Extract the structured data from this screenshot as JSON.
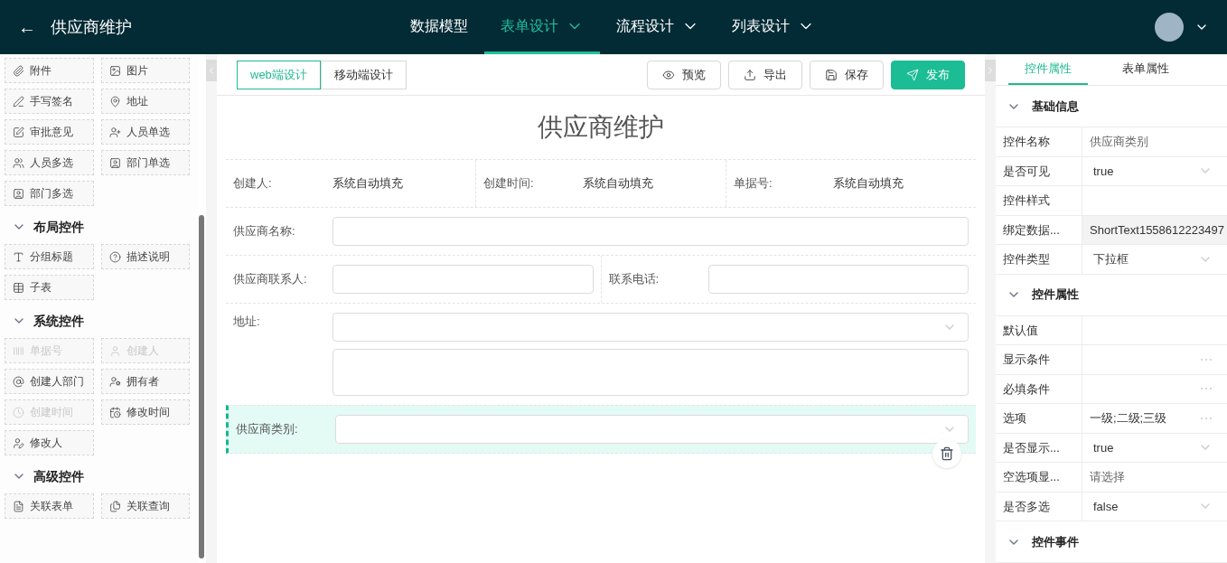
{
  "header": {
    "back": "←",
    "title": "供应商维护",
    "nav": [
      {
        "label": "数据模型",
        "selected": false,
        "dropdown": false
      },
      {
        "label": "表单设计",
        "selected": true,
        "dropdown": true
      },
      {
        "label": "流程设计",
        "selected": false,
        "dropdown": true
      },
      {
        "label": "列表设计",
        "selected": false,
        "dropdown": true
      }
    ]
  },
  "palette": [
    {
      "items": [
        {
          "label": "附件",
          "disabled": false
        },
        {
          "label": "图片",
          "disabled": false
        },
        {
          "label": "手写签名",
          "disabled": false
        },
        {
          "label": "地址",
          "disabled": false
        },
        {
          "label": "审批意见",
          "disabled": false
        },
        {
          "label": "人员单选",
          "disabled": false
        },
        {
          "label": "人员多选",
          "disabled": false
        },
        {
          "label": "部门单选",
          "disabled": false
        },
        {
          "label": "部门多选",
          "disabled": false
        }
      ]
    },
    {
      "title": "布局控件",
      "expanded": true,
      "items": [
        {
          "label": "分组标题",
          "disabled": false
        },
        {
          "label": "描述说明",
          "disabled": false
        },
        {
          "label": "子表",
          "disabled": false
        }
      ]
    },
    {
      "title": "系统控件",
      "expanded": true,
      "items": [
        {
          "label": "单据号",
          "disabled": true
        },
        {
          "label": "创建人",
          "disabled": true
        },
        {
          "label": "创建人部门",
          "disabled": false
        },
        {
          "label": "拥有者",
          "disabled": false
        },
        {
          "label": "创建时间",
          "disabled": true
        },
        {
          "label": "修改时间",
          "disabled": false
        },
        {
          "label": "修改人",
          "disabled": false
        }
      ]
    },
    {
      "title": "高级控件",
      "expanded": true,
      "items": [
        {
          "label": "关联表单",
          "disabled": false
        },
        {
          "label": "关联查询",
          "disabled": false
        }
      ]
    }
  ],
  "toolbar": {
    "modes": [
      {
        "label": "web端设计",
        "selected": true
      },
      {
        "label": "移动端设计",
        "selected": false
      }
    ],
    "actions": [
      {
        "label": "预览",
        "primary": false
      },
      {
        "label": "导出",
        "primary": false
      },
      {
        "label": "保存",
        "primary": false
      },
      {
        "label": "发布",
        "primary": true
      }
    ]
  },
  "form": {
    "title": "供应商维护",
    "rows": [
      {
        "selected": false,
        "fields": [
          {
            "label": "创建人:",
            "kind": "info",
            "value": "系统自动填充"
          },
          {
            "label": "创建时间:",
            "kind": "info",
            "value": "系统自动填充"
          },
          {
            "label": "单据号:",
            "kind": "info",
            "value": "系统自动填充"
          }
        ]
      },
      {
        "selected": false,
        "fields": [
          {
            "label": "供应商名称:",
            "kind": "input"
          }
        ]
      },
      {
        "selected": false,
        "fields": [
          {
            "label": "供应商联系人:",
            "kind": "input"
          },
          {
            "label": "联系电话:",
            "kind": "input"
          }
        ]
      },
      {
        "selected": false,
        "fields": [
          {
            "label": "地址:",
            "kind": "address"
          }
        ]
      },
      {
        "selected": true,
        "fields": [
          {
            "label": "供应商类别:",
            "kind": "select"
          }
        ]
      }
    ]
  },
  "properties": {
    "tabs": [
      {
        "label": "控件属性",
        "selected": true
      },
      {
        "label": "表单属性",
        "selected": false
      }
    ],
    "sections": [
      {
        "title": "基础信息",
        "expanded": true,
        "rows": [
          {
            "label": "控件名称",
            "kind": "text",
            "value": "供应商类别"
          },
          {
            "label": "是否可见",
            "kind": "select",
            "value": "true"
          },
          {
            "label": "控件样式",
            "kind": "text"
          },
          {
            "label": "绑定数据...",
            "kind": "readonly",
            "value": "ShortText1558612223497"
          },
          {
            "label": "控件类型",
            "kind": "select",
            "value": "下拉框"
          }
        ]
      },
      {
        "title": "控件属性",
        "expanded": true,
        "rows": [
          {
            "label": "默认值",
            "kind": "text"
          },
          {
            "label": "显示条件",
            "kind": "more"
          },
          {
            "label": "必填条件",
            "kind": "more"
          },
          {
            "label": "选项",
            "kind": "more",
            "value": "一级;二级;三级"
          },
          {
            "label": "是否显示...",
            "kind": "select",
            "value": "true"
          },
          {
            "label": "空选项显...",
            "kind": "text",
            "value": "请选择"
          },
          {
            "label": "是否多选",
            "kind": "select",
            "value": "false"
          }
        ]
      },
      {
        "title": "控件事件",
        "expanded": true
      }
    ]
  }
}
